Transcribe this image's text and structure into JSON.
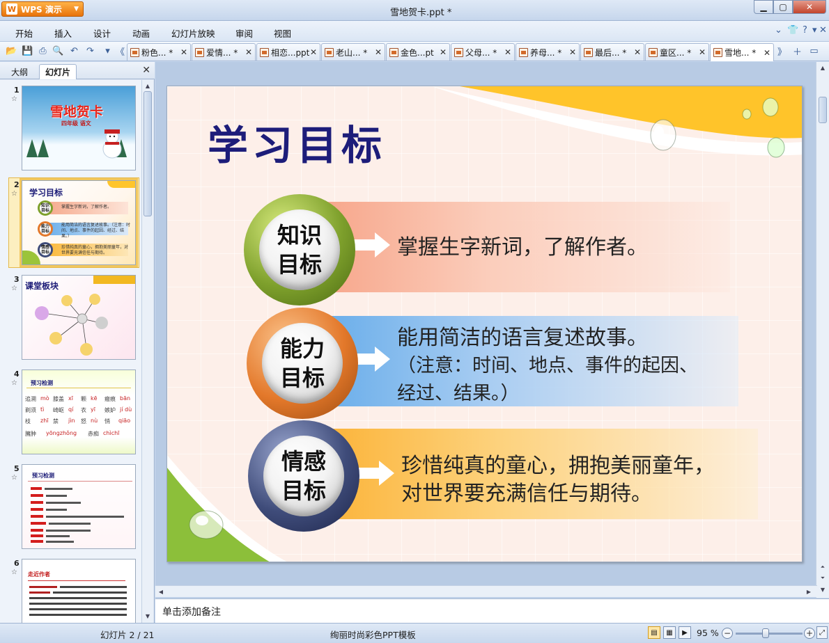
{
  "app": {
    "button_label": "WPS 演示",
    "window_title": "雪地贺卡.ppt *"
  },
  "menu": [
    "开始",
    "插入",
    "设计",
    "动画",
    "幻灯片放映",
    "审阅",
    "视图"
  ],
  "tabs": [
    {
      "label": "粉色... *"
    },
    {
      "label": "爱情... *"
    },
    {
      "label": "相恋...ppt"
    },
    {
      "label": "老山... *"
    },
    {
      "label": "金色...pt"
    },
    {
      "label": "父母... *"
    },
    {
      "label": "养母... *"
    },
    {
      "label": "最后... *"
    },
    {
      "label": "童区... *"
    },
    {
      "label": "雪地... *",
      "active": true
    }
  ],
  "left_panel": {
    "tabs": [
      "大纲",
      "幻灯片"
    ],
    "active_tab": "幻灯片"
  },
  "thumbnails": [
    {
      "num": "1",
      "title": "雪地贺卡",
      "subtitle": "四年级 语文"
    },
    {
      "num": "2",
      "title": "学习目标",
      "selected": true,
      "items": [
        {
          "badge": "知识\n目标",
          "text": "掌握生字新词，了解作者。"
        },
        {
          "badge": "能力\n目标",
          "text": "能用简洁的语言复述故事。（注意：时间、地点、事件的起因、经过、结果。）"
        },
        {
          "badge": "情感\n目标",
          "text": "珍惜纯真的童心，拥抱美丽童年，对世界要充满信任与期待。"
        }
      ]
    },
    {
      "num": "3",
      "title": "课堂板块"
    },
    {
      "num": "4",
      "title": "预习检测",
      "pinyin": [
        "mò",
        "xī",
        "kē",
        "bān",
        "tì",
        "qí",
        "yī",
        "jí dù",
        "zhī",
        "jìn",
        "nù",
        "qiāo",
        "yōngzhǒng",
        "chìchī"
      ]
    },
    {
      "num": "5",
      "title": "预习检测"
    },
    {
      "num": "6",
      "title": "走近作者"
    }
  ],
  "slide": {
    "title": "学习目标",
    "objectives": [
      {
        "badge_line1": "知识",
        "badge_line2": "目标",
        "lines": [
          "掌握生字新词，了解作者。"
        ],
        "color": "#7ea02c"
      },
      {
        "badge_line1": "能力",
        "badge_line2": "目标",
        "lines": [
          "能用简洁的语言复述故事。",
          "（注意：时间、地点、事件的起因、",
          "经过、结果。）"
        ],
        "color": "#e3782a"
      },
      {
        "badge_line1": "情感",
        "badge_line2": "目标",
        "lines": [
          "珍惜纯真的童心，拥抱美丽童年，",
          "对世界要充满信任与期待。"
        ],
        "color": "#3f4c7a"
      }
    ]
  },
  "notes_placeholder": "单击添加备注",
  "status": {
    "slide_counter": "幻灯片 2 / 21",
    "template_name": "绚丽时尚彩色PPT模板",
    "zoom": "95 %"
  },
  "icons": {
    "open": "folder-open-icon",
    "save": "save-icon",
    "print": "print-icon",
    "preview": "print-preview-icon",
    "undo": "undo-icon",
    "redo": "redo-icon"
  },
  "colors": {
    "title_blue": "#1d1d7a",
    "accent_orange": "#e8730c",
    "selected_thumb": "#f2c75c"
  }
}
